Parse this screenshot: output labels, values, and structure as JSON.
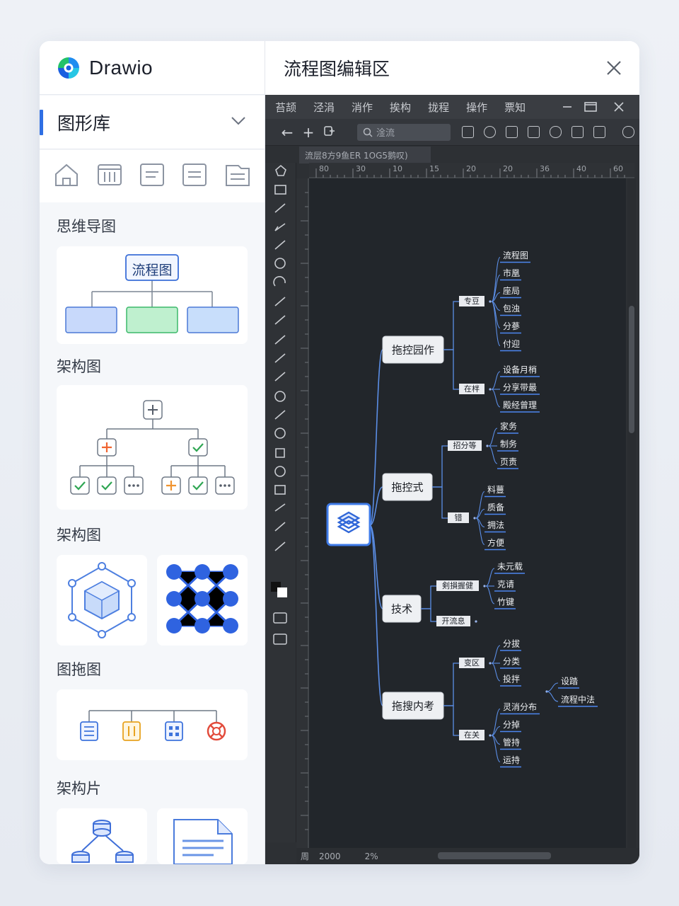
{
  "brand": {
    "name": "Drawio"
  },
  "library": {
    "title": "图形库"
  },
  "sections": [
    {
      "title": "思维导图",
      "root_label": "流程图"
    },
    {
      "title": "架构图"
    },
    {
      "title": "架构图"
    },
    {
      "title": "图拖图"
    },
    {
      "title": "架构片"
    }
  ],
  "editor": {
    "title": "流程图编辑区",
    "menu": [
      "苔颉",
      "泾涓",
      "消作",
      "挨构",
      "拢程",
      "操作",
      "票知"
    ],
    "search_placeholder": "淦流",
    "doc_tab": "流层8方9鱼ER 1OG5鹅叹)",
    "ruler_ticks": [
      "80",
      "30",
      "10",
      "15",
      "20",
      "20",
      "36",
      "40",
      "60"
    ],
    "status": {
      "left": "周",
      "page": "2000",
      "zoom": "2%"
    }
  },
  "mindmap": {
    "branches": [
      {
        "label": "拖控园作",
        "groups": [
          {
            "label": "专豆",
            "leaves": [
              "流程图",
              "市凰",
              "座局",
              "包浊",
              "分蔘",
              "付迎"
            ]
          },
          {
            "label": "在柈",
            "leaves": [
              "设备月梢",
              "分享带最",
              "殿经曾理"
            ]
          }
        ]
      },
      {
        "label": "拖控式",
        "groups": [
          {
            "label": "招分等",
            "leaves": [
              "家务",
              "制务",
              "页责"
            ]
          },
          {
            "label": "错",
            "leaves": [
              "料蘴",
              "质备",
              "拥法",
              "方便"
            ]
          }
        ]
      },
      {
        "label": "技术",
        "groups": [
          {
            "label": "剣損握健",
            "leaves": [
              "未元载",
              "克请",
              "竹键"
            ]
          },
          {
            "label": "开流息",
            "leaves": []
          }
        ]
      },
      {
        "label": "拖搜内考",
        "groups": [
          {
            "label": "变区",
            "leaves": [
              "分拔",
              "分类",
              "投拌"
            ]
          },
          {
            "label": "在关",
            "leaves": [
              "灵消分布",
              "分掉",
              "管持",
              "运持"
            ]
          }
        ],
        "extra": {
          "label": "灵消分布",
          "leaves": [
            "设踏",
            "流程中法"
          ]
        }
      }
    ]
  },
  "colors": {
    "accent": "#2f6fe4",
    "canvas": "#22262b",
    "node_fill": "#eef0f3",
    "connector": "#5b8ee6"
  }
}
